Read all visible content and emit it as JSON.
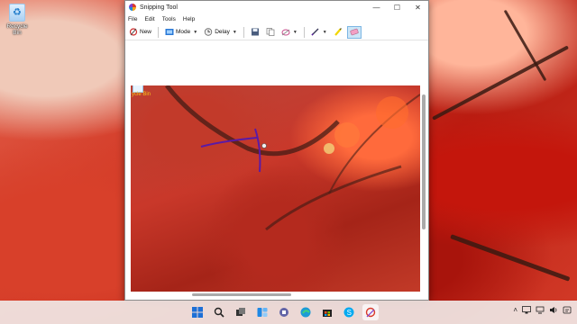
{
  "desktop": {
    "recycle_bin_label": "Recycle Bin"
  },
  "window": {
    "title": "Snipping Tool",
    "menu": [
      "File",
      "Edit",
      "Tools",
      "Help"
    ],
    "toolbar": {
      "new_label": "New",
      "mode_label": "Mode",
      "delay_label": "Delay"
    },
    "snip": {
      "label": "ycle Bin"
    }
  },
  "taskbar": {
    "icons": [
      "windows-start-icon",
      "search-icon",
      "task-view-icon",
      "widgets-icon",
      "teams-chat-icon",
      "edge-icon",
      "store-icon",
      "skype-icon",
      "snipping-tool-icon"
    ]
  },
  "colors": {
    "accent": "#1d6fd6",
    "ink_pen": "#5a1aa6",
    "toolbar_active": "#cde6f7"
  }
}
